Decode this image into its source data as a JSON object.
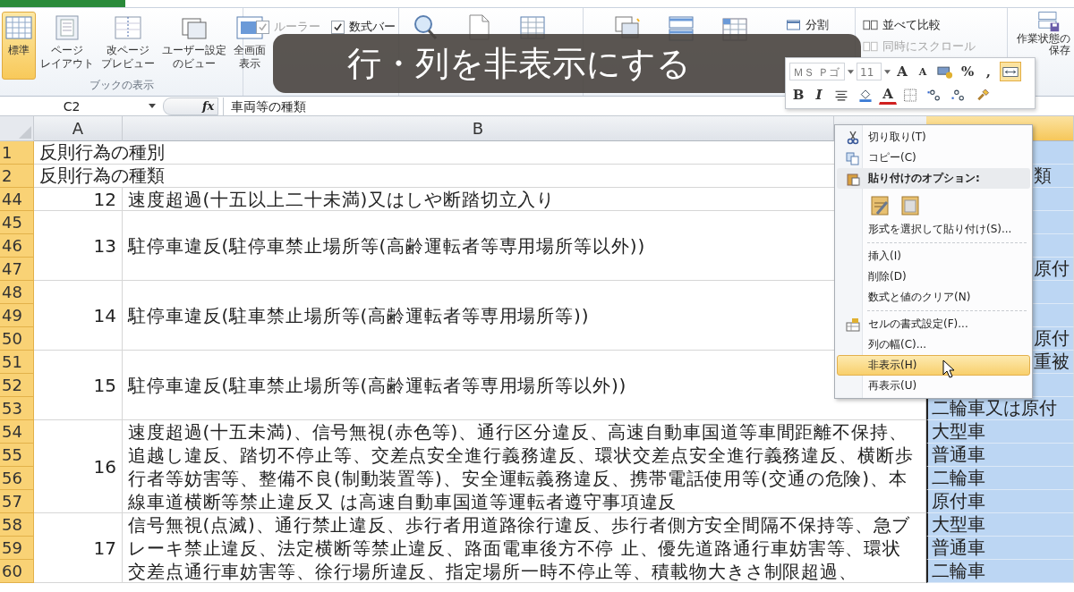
{
  "ribbon": {
    "view_group": {
      "label": "ブックの表示",
      "buttons": [
        {
          "kind": "normal",
          "lines": [
            "標準"
          ],
          "selected": true
        },
        {
          "kind": "page-layout",
          "lines": [
            "ページ",
            "レイアウト"
          ],
          "selected": false
        },
        {
          "kind": "page-break",
          "lines": [
            "改ページ",
            "プレビュー"
          ],
          "selected": false
        },
        {
          "kind": "custom-view",
          "lines": [
            "ユーザー設定",
            "のビュー"
          ],
          "selected": false
        },
        {
          "kind": "full-screen",
          "lines": [
            "全画面",
            "表示"
          ],
          "selected": false
        }
      ]
    },
    "show_group": {
      "checkboxes": [
        {
          "label": "ルーラー",
          "checked": true,
          "disabled": true
        },
        {
          "label": "数式バー",
          "checked": true,
          "disabled": false
        }
      ]
    },
    "window_group": {
      "split": "分割"
    },
    "compare": [
      {
        "label": "並べて比較",
        "disabled": false
      },
      {
        "label": "同時にスクロール",
        "disabled": true
      }
    ],
    "save_workspace": {
      "lines": [
        "作業状態の",
        "保存"
      ]
    }
  },
  "caption": "行・列を非表示にする",
  "formula_bar": {
    "name_box": "C2",
    "fx": "fx",
    "formula": "車両等の種類"
  },
  "mini_toolbar": {
    "font": "ＭＳ Ｐゴ",
    "size": "11",
    "row1": [
      {
        "kind": "grow",
        "text": "A",
        "selected": false
      },
      {
        "kind": "shrink",
        "text": "A",
        "selected": false
      },
      {
        "kind": "accounting",
        "selected": false
      },
      {
        "kind": "percent",
        "text": "%",
        "selected": false
      },
      {
        "kind": "comma",
        "text": ",",
        "selected": false
      },
      {
        "kind": "merge",
        "selected": true
      }
    ],
    "row2": [
      {
        "kind": "bold",
        "text": "B"
      },
      {
        "kind": "italic",
        "text": "I"
      },
      {
        "kind": "center"
      },
      {
        "kind": "fill"
      },
      {
        "kind": "font-color",
        "text": "A"
      },
      {
        "kind": "border"
      },
      {
        "kind": "dec-more"
      },
      {
        "kind": "dec-less"
      },
      {
        "kind": "painter"
      }
    ]
  },
  "context_menu": {
    "items": [
      {
        "kind": "cut",
        "label": "切り取り(T)",
        "selected": false
      },
      {
        "kind": "copy",
        "label": "コピー(C)",
        "selected": false
      },
      {
        "kind": "header",
        "label": "貼り付けのオプション:"
      },
      {
        "kind": "paste-icons"
      },
      {
        "kind": "plain",
        "label": "形式を選択して貼り付け(S)...",
        "selected": false
      },
      {
        "kind": "separator"
      },
      {
        "kind": "plain",
        "label": "挿入(I)",
        "selected": false
      },
      {
        "kind": "plain",
        "label": "削除(D)",
        "selected": false
      },
      {
        "kind": "plain",
        "label": "数式と値のクリア(N)",
        "selected": false
      },
      {
        "kind": "separator"
      },
      {
        "kind": "format",
        "label": "セルの書式設定(F)...",
        "selected": false
      },
      {
        "kind": "plain",
        "label": "列の幅(C)...",
        "selected": false
      },
      {
        "kind": "plain",
        "label": "非表示(H)",
        "selected": true
      },
      {
        "kind": "plain",
        "label": "再表示(U)",
        "selected": false
      }
    ]
  },
  "sheet": {
    "columns": [
      {
        "label": "A",
        "selected": false
      },
      {
        "label": "B",
        "selected": false
      },
      {
        "selected": true
      }
    ],
    "blocks": [
      {
        "kind": "overflow",
        "text": "反則行為の種別",
        "rows": [
          {
            "number": "1",
            "selected": true
          }
        ]
      },
      {
        "kind": "overflow",
        "text": "反則行為の種類",
        "rows": [
          {
            "number": "2",
            "selected": true,
            "c": "類",
            "covered": true
          }
        ]
      },
      {
        "kind": "merged",
        "number": "12",
        "text": "速度超過(十五以上二十未満)又はしや断踏切立入り",
        "rows": [
          {
            "number": "44",
            "selected": true
          }
        ]
      },
      {
        "kind": "merged",
        "number": "13",
        "text": "駐停車違反(駐停車禁止場所等(高齢運転者等専用場所等以外))",
        "rows": [
          {
            "number": "45",
            "selected": true
          },
          {
            "number": "46",
            "selected": true
          },
          {
            "number": "47",
            "selected": true,
            "c": "原付",
            "covered": true
          }
        ]
      },
      {
        "kind": "merged",
        "number": "14",
        "text": "駐停車違反(駐車禁止場所等(高齢運転者等専用場所等))",
        "rows": [
          {
            "number": "48",
            "selected": true
          },
          {
            "number": "49",
            "selected": true
          },
          {
            "number": "50",
            "selected": true,
            "c": "原付",
            "covered": true
          }
        ]
      },
      {
        "kind": "merged",
        "number": "15",
        "text": "駐停車違反(駐車禁止場所等(高齢運転者等専用場所等以外))",
        "rows": [
          {
            "number": "51",
            "selected": true,
            "c": "重被",
            "covered": true
          },
          {
            "number": "52",
            "selected": true
          },
          {
            "number": "53",
            "selected": true,
            "c": "二輪車又は原付",
            "covered": false
          }
        ]
      },
      {
        "kind": "merged",
        "number": "16",
        "text": "速度超過(十五未満)、信号無視(赤色等)、通行区分違反、高速自動車国道等車間距離不保持、追越し違反、踏切不停止等、交差点安全進行義務違反、環状交差点安全進行義務違反、横断歩行者等妨害等、整備不良(制動装置等)、安全運転義務違反、携帯電話使用等(交通の危険)、本線車道横断等禁止違反又 は高速自動車国道等運転者遵守事項違反",
        "rows": [
          {
            "number": "54",
            "selected": true,
            "c": "大型車",
            "covered": false
          },
          {
            "number": "55",
            "selected": true,
            "c": "普通車",
            "covered": false
          },
          {
            "number": "56",
            "selected": true,
            "c": "二輪車",
            "covered": false
          },
          {
            "number": "57",
            "selected": true,
            "c": "原付車",
            "covered": false
          }
        ]
      },
      {
        "kind": "merged",
        "number": "17",
        "text": "信号無視(点滅)、通行禁止違反、歩行者用道路徐行違反、歩行者側方安全間隔不保持等、急ブレーキ禁止違反、法定横断等禁止違反、路面電車後方不停 止、優先道路通行車妨害等、環状交差点通行車妨害等、徐行場所違反、指定場所一時不停止等、積載物大きさ制限超過、",
        "rows": [
          {
            "number": "58",
            "selected": true,
            "c": "大型車",
            "covered": false
          },
          {
            "number": "59",
            "selected": true,
            "c": "普通車",
            "covered": false
          },
          {
            "number": "60",
            "selected": true,
            "c": "二輪車",
            "covered": false
          }
        ]
      }
    ]
  }
}
